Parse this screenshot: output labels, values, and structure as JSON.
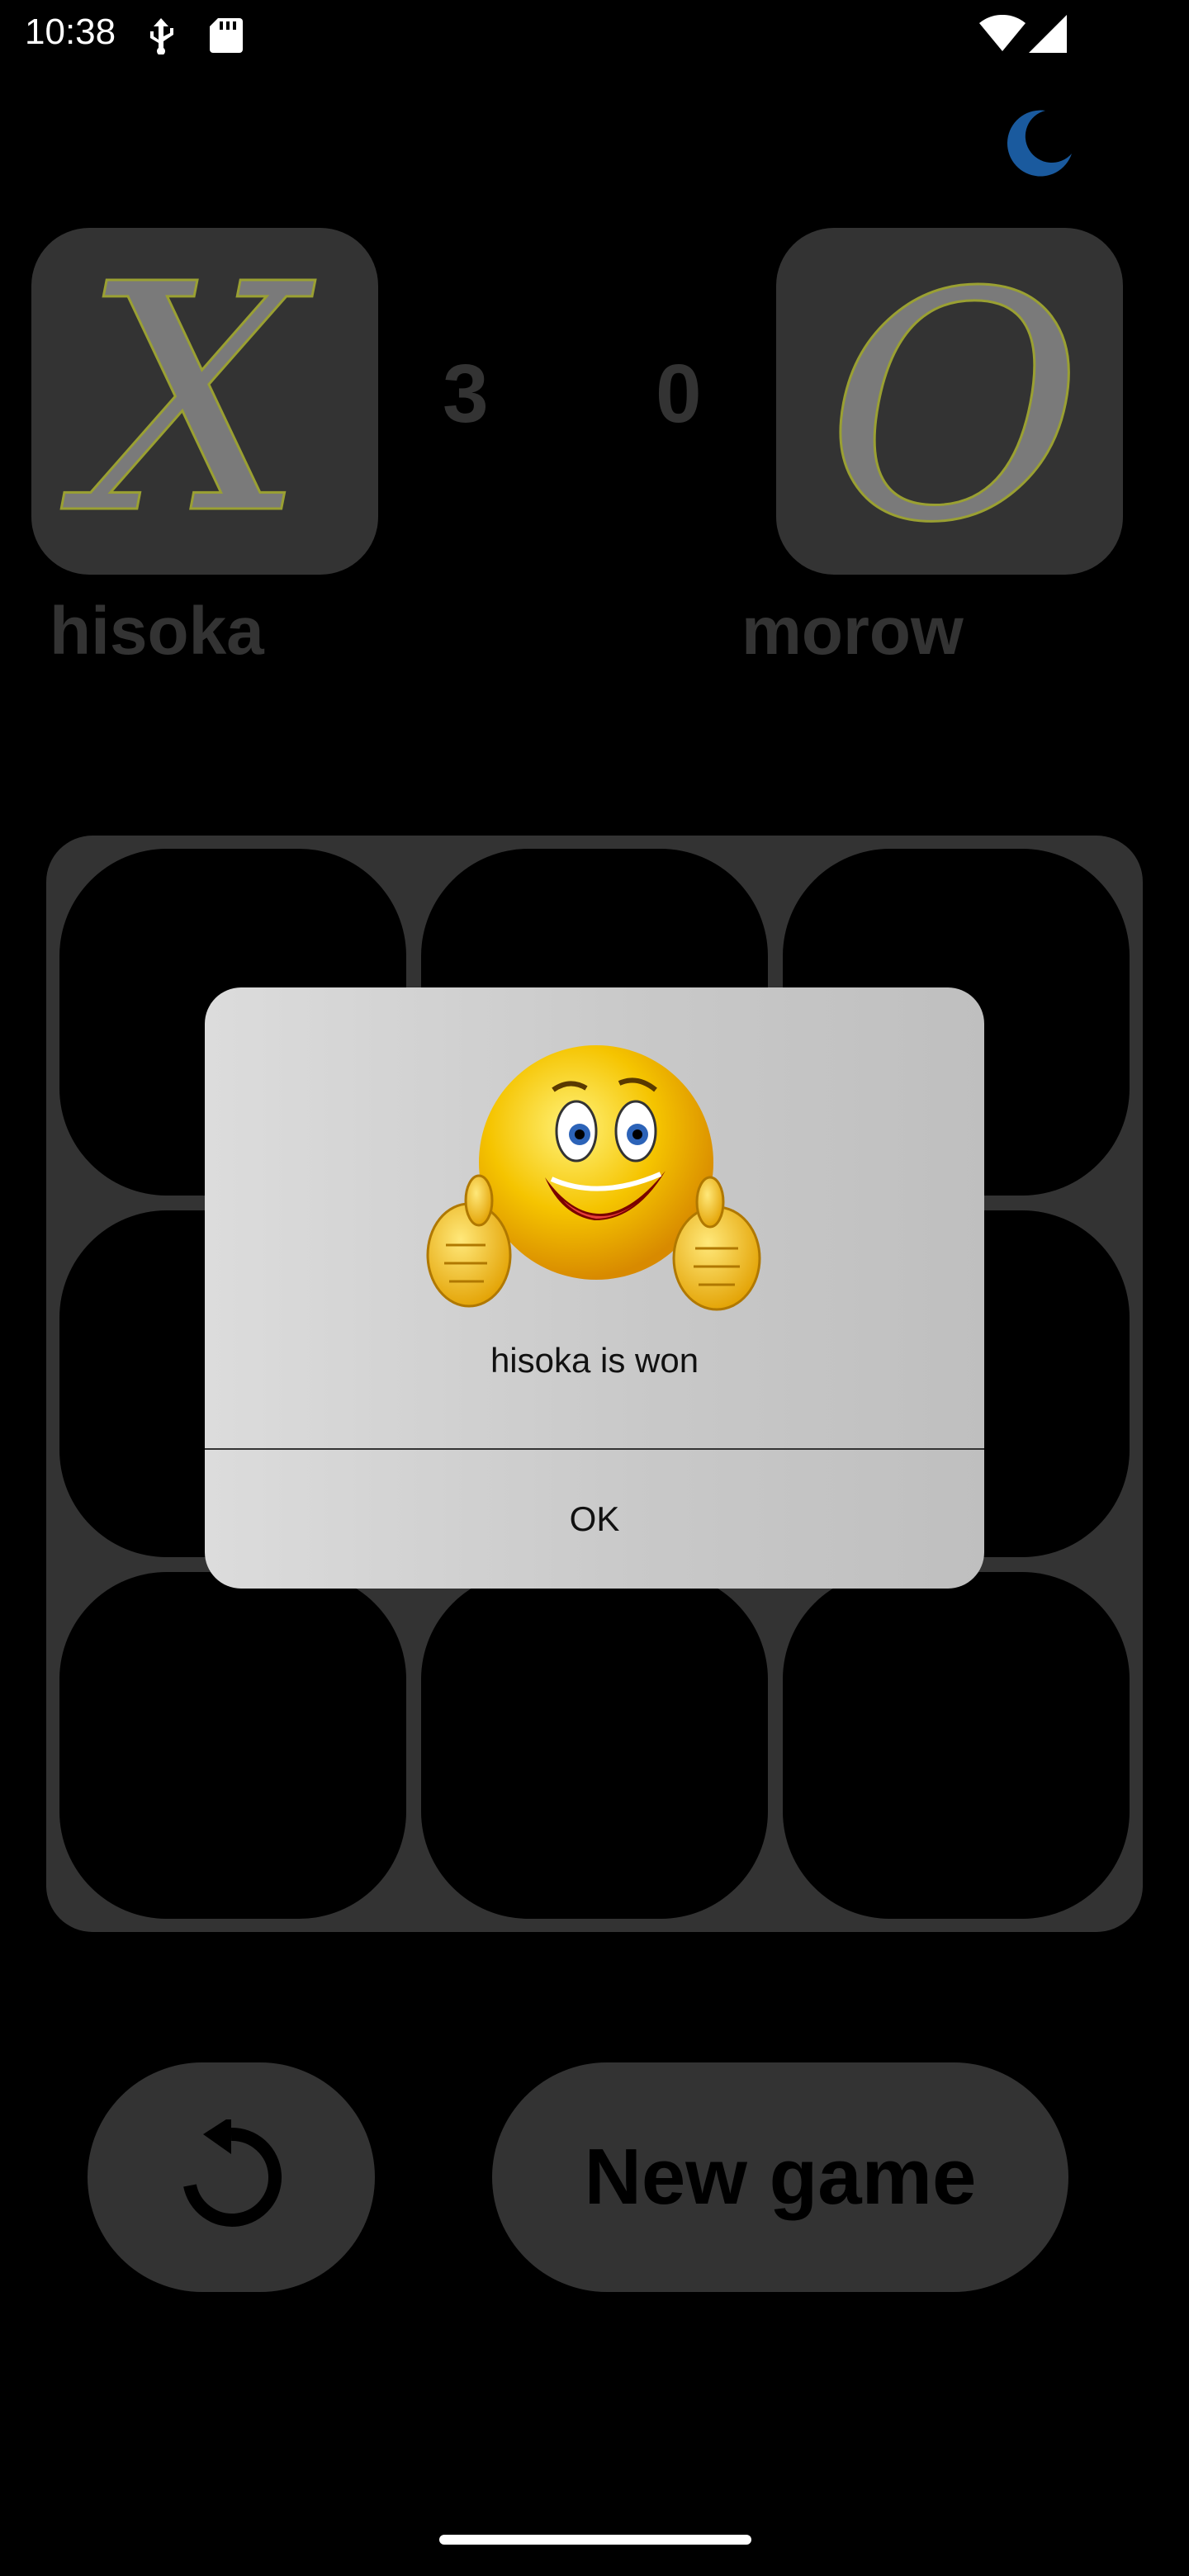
{
  "status": {
    "time": "10:38"
  },
  "players": {
    "x": {
      "symbol": "X",
      "name": "hisoka",
      "score": "3"
    },
    "o": {
      "symbol": "O",
      "name": "morow",
      "score": "0"
    }
  },
  "actions": {
    "new_game": "New game"
  },
  "dialog": {
    "message": "hisoka is won",
    "ok": "OK"
  },
  "colors": {
    "tile": "#333333",
    "accent_moon": "#1a5a9e",
    "letter_fill": "#7a7a7a",
    "letter_outline": "#9aa032"
  }
}
